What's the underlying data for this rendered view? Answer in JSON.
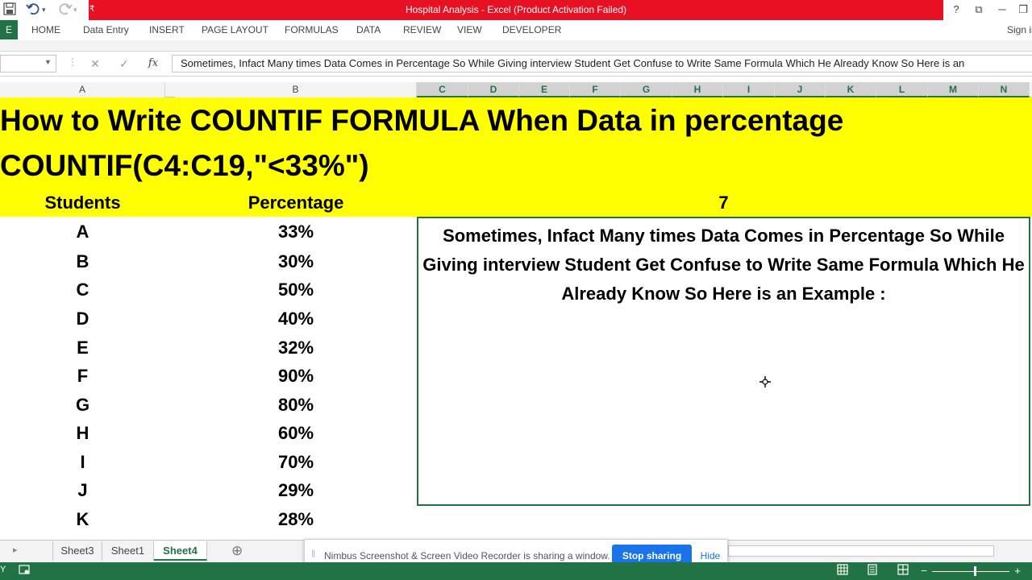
{
  "window": {
    "title": "Hospital Analysis -  Excel (Product Activation Failed)",
    "sign_in": "Sign in",
    "help": "?",
    "minimize": "─",
    "restore": "❐",
    "ribbon_display": "⧉"
  },
  "qat": {
    "save_icon": "save-icon",
    "undo_icon": "undo-icon",
    "redo_icon": "redo-icon",
    "customize_icon": "customize-icon"
  },
  "ribbon": {
    "file_label": "E",
    "tabs": [
      "HOME",
      "Data Entry",
      "INSERT",
      "PAGE LAYOUT",
      "FORMULAS",
      "DATA",
      "REVIEW",
      "VIEW",
      "DEVELOPER"
    ]
  },
  "formula_bar": {
    "name_box_value": "",
    "cancel_symbol": "✕",
    "enter_symbol": "✓",
    "fx_symbol": "fx",
    "content": "Sometimes, Infact Many times Data Comes in Percentage So While Giving interview Student Get Confuse to Write Same Formula Which He Already Know So Here is an"
  },
  "columns": [
    "A",
    "B",
    "C",
    "D",
    "E",
    "F",
    "G",
    "H",
    "I",
    "J",
    "K",
    "L",
    "M",
    "N"
  ],
  "sheet": {
    "heading1": "How to Write COUNTIF FORMULA When Data in percentage",
    "heading2": "COUNTIF(C4:C19,\"<33%\")",
    "col_a_header": "Students",
    "col_b_header": "Percentage",
    "result_value": "7",
    "rows": [
      {
        "student": "A",
        "pct": "33%"
      },
      {
        "student": "B",
        "pct": "30%"
      },
      {
        "student": "C",
        "pct": "50%"
      },
      {
        "student": "D",
        "pct": "40%"
      },
      {
        "student": "E",
        "pct": "32%"
      },
      {
        "student": "F",
        "pct": "90%"
      },
      {
        "student": "G",
        "pct": "80%"
      },
      {
        "student": "H",
        "pct": "60%"
      },
      {
        "student": "I",
        "pct": "70%"
      },
      {
        "student": "J",
        "pct": "29%"
      },
      {
        "student": "K",
        "pct": "28%"
      }
    ],
    "textbox": "Sometimes, Infact Many times Data Comes in Percentage So While Giving interview Student Get Confuse to Write Same Formula Which He Already Know So Here is an Example :"
  },
  "sheet_tabs": {
    "tabs": [
      "Sheet3",
      "Sheet1",
      "Sheet4"
    ],
    "active": "Sheet4",
    "add_symbol": "⊕",
    "nav_symbol": "▸"
  },
  "sharing": {
    "message": "Nimbus Screenshot & Screen Video Recorder is sharing a window.",
    "stop_label": "Stop sharing",
    "hide_label": "Hide"
  },
  "status": {
    "ready_label": "Y",
    "zoom_minus": "−",
    "zoom_plus": "+",
    "zoom_level": 0.55
  },
  "colors": {
    "excel_green": "#217346",
    "title_red": "#e81123",
    "highlight_yellow": "#ffff00",
    "share_blue": "#1a73e8"
  }
}
